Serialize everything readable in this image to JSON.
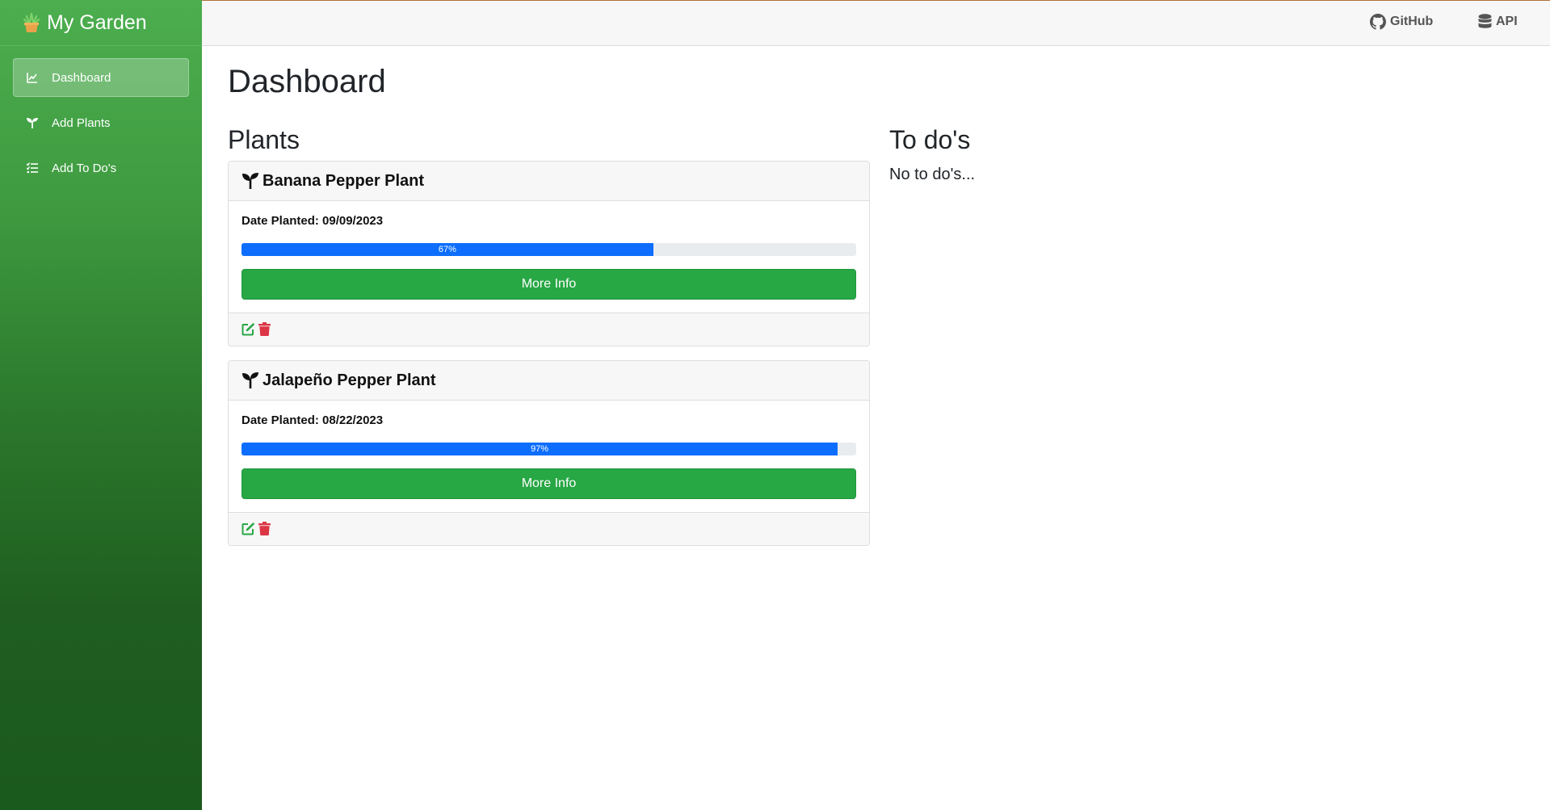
{
  "brand": {
    "title": "My Garden"
  },
  "sidebar": {
    "items": [
      {
        "label": "Dashboard",
        "icon": "chart-line-icon",
        "active": true
      },
      {
        "label": "Add Plants",
        "icon": "seedling-icon",
        "active": false
      },
      {
        "label": "Add To Do's",
        "icon": "list-check-icon",
        "active": false
      }
    ]
  },
  "topbar": {
    "github_label": "GitHub",
    "api_label": "API"
  },
  "main": {
    "title": "Dashboard",
    "plants_heading": "Plants",
    "todos_heading": "To do's",
    "todos_empty": "No to do's..."
  },
  "plants": [
    {
      "name": "Banana Pepper Plant",
      "date_label": "Date Planted: 09/09/2023",
      "progress": 67,
      "progress_label": "67%",
      "button_label": "More Info"
    },
    {
      "name": "Jalapeño Pepper Plant",
      "date_label": "Date Planted: 08/22/2023",
      "progress": 97,
      "progress_label": "97%",
      "button_label": "More Info"
    }
  ],
  "colors": {
    "accent_green": "#28a745",
    "progress_blue": "#0d6efd",
    "delete_red": "#dc3545"
  }
}
